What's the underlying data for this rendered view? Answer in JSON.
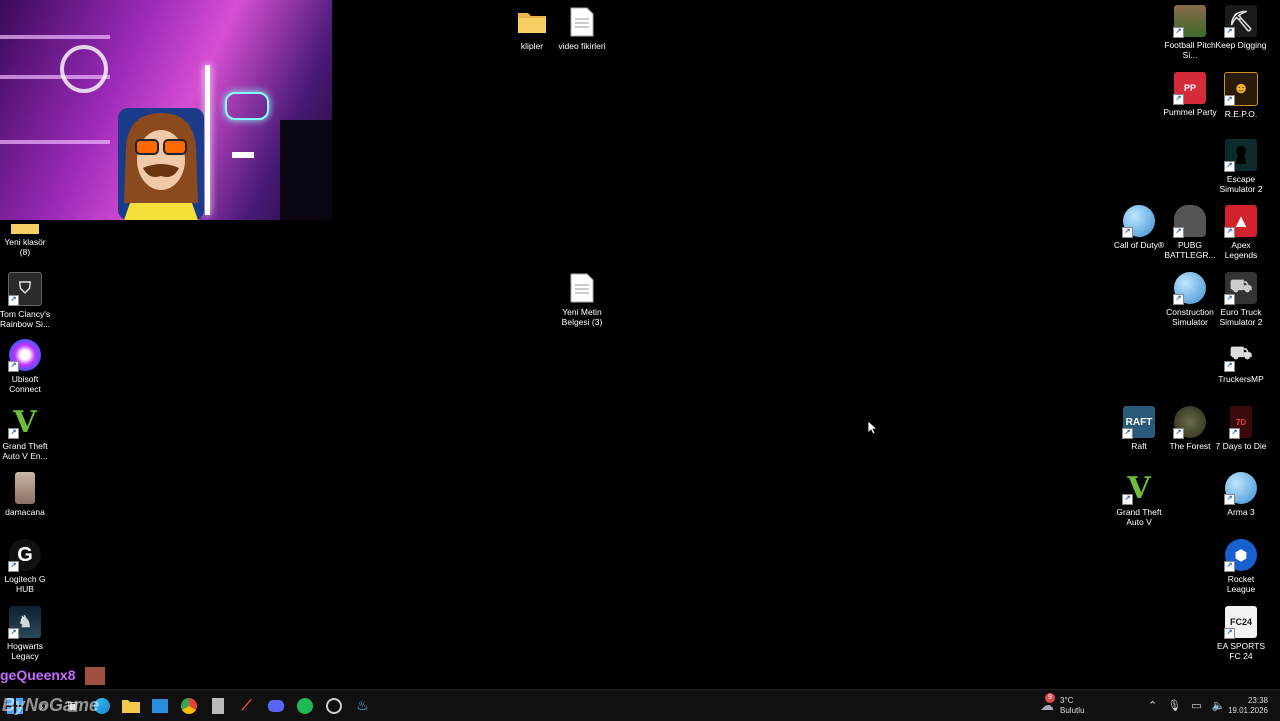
{
  "desktop": {
    "icons_top": [
      {
        "label": "klipler",
        "type": "folder"
      },
      {
        "label": "video fikirleri",
        "type": "document"
      }
    ],
    "icon_center": {
      "label": "Yeni Metin Belgesi (3)",
      "type": "document"
    },
    "icons_left": [
      {
        "label": "Yeni klasör (8)",
        "type": "folder"
      },
      {
        "label": "Tom Clancy's Rainbow Si...",
        "type": "game"
      },
      {
        "label": "Ubisoft Connect",
        "type": "launcher"
      },
      {
        "label": "Grand Theft Auto V En...",
        "type": "game"
      },
      {
        "label": "damacana",
        "type": "image"
      },
      {
        "label": "Logitech G HUB",
        "type": "app"
      },
      {
        "label": "Hogwarts Legacy",
        "type": "game"
      }
    ],
    "icons_right": [
      {
        "label": "Football Pitch Si..."
      },
      {
        "label": "Keep Digging"
      },
      {
        "label": "Pummel Party"
      },
      {
        "label": "R.E.P.O."
      },
      {
        "label": "Escape Simulator 2"
      },
      {
        "label": "Call of Duty®"
      },
      {
        "label": "PUBG BATTLEGR..."
      },
      {
        "label": "Apex Legends"
      },
      {
        "label": "Construction Simulator"
      },
      {
        "label": "Euro Truck Simulator 2"
      },
      {
        "label": "TruckersMP"
      },
      {
        "label": "Raft"
      },
      {
        "label": "The Forest"
      },
      {
        "label": "7 Days to Die"
      },
      {
        "label": "Grand Theft Auto V"
      },
      {
        "label": "Arma 3"
      },
      {
        "label": "Rocket League"
      },
      {
        "label": "EA SPORTS FC 24"
      }
    ]
  },
  "overlay": {
    "streamer_name": "geQueenx8",
    "watermark": "ByNoGame"
  },
  "taskbar": {
    "weather_temp": "3°C",
    "weather_desc": "Bulutlu",
    "weather_badge": "9",
    "time": "23:38",
    "date": "19.01.2026"
  },
  "colors": {
    "desktop_bg": "#000000",
    "taskbar_bg": "#101010",
    "streamer_text": "#c46bff"
  }
}
